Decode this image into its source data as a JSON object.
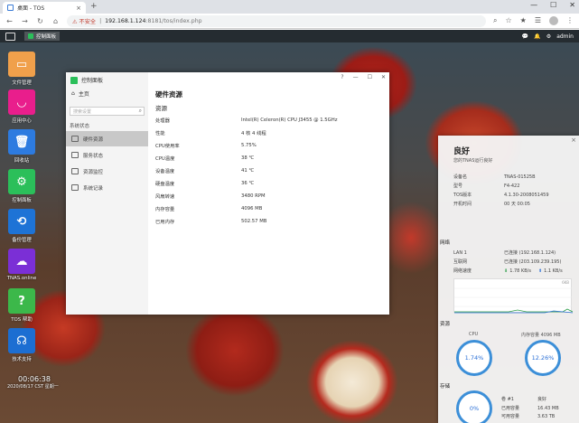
{
  "browser": {
    "tab_title": "桌面 - TOS",
    "tab_close": "×",
    "new_tab": "+",
    "controls": [
      "—",
      "☐",
      "✕"
    ],
    "nav": [
      "←",
      "→",
      "↻",
      "⌂"
    ],
    "url_warning": "⚠ 不安全",
    "url_sep": "|",
    "url_host": "192.168.1.124",
    "url_path": ":8181/tos/index.php",
    "addr_icons": [
      "⌕",
      "☆",
      "★",
      "☰"
    ],
    "menu": "⋮"
  },
  "desktop": {
    "taskbar_app": "控制面板",
    "top_right": {
      "chat": "💬",
      "bell": "🔔",
      "gear": "⚙",
      "user": "admin"
    },
    "icons": [
      {
        "label": "文件管理",
        "color": "#f0a04b",
        "glyph": "▭"
      },
      {
        "label": "应用中心",
        "color": "#e91e8c",
        "glyph": "◡"
      },
      {
        "label": "回收站",
        "color": "#2d7be0",
        "glyph": "🗑"
      },
      {
        "label": "控制面板",
        "color": "#2bbf5a",
        "glyph": "⚙"
      },
      {
        "label": "备份管理",
        "color": "#1e73d6",
        "glyph": "⟲"
      },
      {
        "label": "TNAS.online",
        "color": "#7b2fd6",
        "glyph": "☁"
      },
      {
        "label": "TOS 帮助",
        "color": "#3cb84a",
        "glyph": "?"
      },
      {
        "label": "技术支持",
        "color": "#1c6ed2",
        "glyph": "☊"
      }
    ],
    "clock_time": "00:06:38",
    "clock_date": "2020/08/17 CST 星期一"
  },
  "control_panel": {
    "title": "控制面板",
    "home": "主页",
    "search_placeholder": "搜索设置",
    "section": "系统状态",
    "nav": [
      "硬件资源",
      "服务状态",
      "资源监控",
      "系统记录"
    ],
    "win_controls": [
      "?",
      "—",
      "☐",
      "✕"
    ],
    "heading": "硬件资源",
    "subheading": "资源",
    "rows": [
      {
        "k": "处理器",
        "v": "Intel(R) Celeron(R) CPU J3455 @ 1.5GHz"
      },
      {
        "k": "性能",
        "v": "4 核 4 线程"
      },
      {
        "k": "CPU使用率",
        "v": "5.75%"
      },
      {
        "k": "CPU温度",
        "v": "38 ℃"
      },
      {
        "k": "设备温度",
        "v": "41 ℃"
      },
      {
        "k": "硬盘温度",
        "v": "36 ℃"
      },
      {
        "k": "风扇转速",
        "v": "3480 RPM"
      },
      {
        "k": "内存容量",
        "v": "4096 MB"
      },
      {
        "k": "已用内存",
        "v": "502.57 MB"
      }
    ]
  },
  "widget": {
    "close": "×",
    "status": "良好",
    "status_sub": "您的TNAS运行良好",
    "info": [
      {
        "k": "设备名",
        "v": "TNAS-01525B"
      },
      {
        "k": "型号",
        "v": "F4-422"
      },
      {
        "k": "TOS版本",
        "v": "4.1.30-2008051459"
      },
      {
        "k": "开机时间",
        "v": "00 天 00:05"
      }
    ],
    "network_label": "网络",
    "network": [
      {
        "k": "LAN 1",
        "v": "已连接 (192.168.1.124)"
      },
      {
        "k": "互联网",
        "v": "已连接 (203.109.239.195)"
      }
    ],
    "speed_label": "网络速度",
    "speed_down": "1.78 KB/s",
    "speed_up": "1.1 KB/s",
    "graph_max": "6KB",
    "resource_label": "资源",
    "cpu_label": "CPU",
    "cpu_value": "1.74%",
    "cpu_fraction": 0.0174,
    "mem_label": "内存容量 4096 MB",
    "mem_value": "12.26%",
    "mem_fraction": 0.1226,
    "storage_label": "存储",
    "storage_value": "0%",
    "volume": {
      "k": "卷 #1",
      "v": "良好"
    },
    "used": {
      "k": "已用容量",
      "v": "16.43 MB"
    },
    "avail": {
      "k": "可用容量",
      "v": "3.63 TB"
    }
  }
}
